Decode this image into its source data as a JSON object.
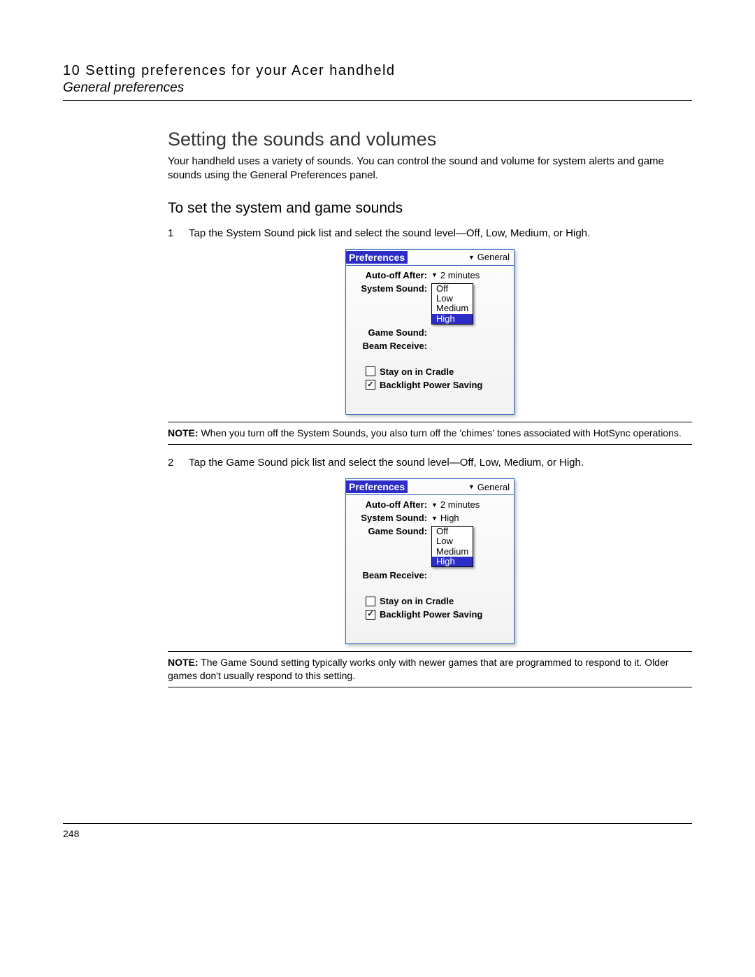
{
  "header": {
    "chapter": "10 Setting preferences for your Acer handheld",
    "section": "General preferences"
  },
  "section_title": "Setting the sounds and volumes",
  "intro": "Your handheld uses a variety of sounds. You can control the sound and volume for system alerts and game sounds using the General Preferences panel.",
  "subheading": "To set the system and game sounds",
  "step1": {
    "num": "1",
    "text": "Tap the System Sound pick list and select the sound level—Off, Low, Medium, or High."
  },
  "fig1": {
    "title": "Preferences",
    "category": "General",
    "autooff_label": "Auto-off After:",
    "autooff_value": "2 minutes",
    "system_label": "System Sound:",
    "game_label": "Game Sound:",
    "beam_label": "Beam Receive:",
    "options": [
      "Off",
      "Low",
      "Medium",
      "High"
    ],
    "selected": "High",
    "stay_cradle": "Stay on in Cradle",
    "backlight": "Backlight Power Saving"
  },
  "note1_label": "NOTE:",
  "note1": "When you turn off the System Sounds, you also turn off the 'chimes' tones associated with HotSync operations.",
  "step2": {
    "num": "2",
    "text": "Tap the Game Sound pick list and select the sound level—Off, Low, Medium, or High."
  },
  "fig2": {
    "title": "Preferences",
    "category": "General",
    "autooff_label": "Auto-off After:",
    "autooff_value": "2 minutes",
    "system_label": "System Sound:",
    "system_value": "High",
    "game_label": "Game Sound:",
    "beam_label": "Beam Receive:",
    "options": [
      "Off",
      "Low",
      "Medium",
      "High"
    ],
    "selected": "High",
    "stay_cradle": "Stay on in Cradle",
    "backlight": "Backlight Power Saving"
  },
  "note2_label": "NOTE:",
  "note2": "The Game Sound setting typically works only with newer games that are programmed to respond to it. Older games don't usually respond to this setting.",
  "page_number": "248"
}
